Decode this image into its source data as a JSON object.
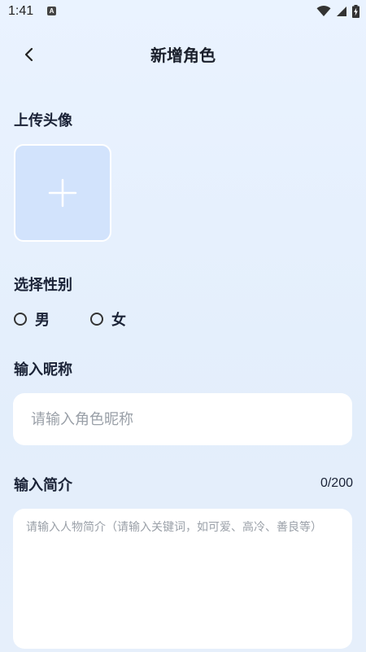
{
  "status_bar": {
    "time": "1:41",
    "notification_badge": "A",
    "icons": [
      "wifi-icon",
      "signal-icon",
      "battery-charging-icon"
    ]
  },
  "header": {
    "title": "新增角色",
    "back_icon": "chevron-left-icon"
  },
  "avatar": {
    "label": "上传头像",
    "upload_icon": "plus-icon"
  },
  "gender": {
    "label": "选择性别",
    "options": [
      {
        "label": "男",
        "selected": false
      },
      {
        "label": "女",
        "selected": false
      }
    ]
  },
  "nickname": {
    "label": "输入昵称",
    "value": "",
    "placeholder": "请输入角色昵称"
  },
  "intro": {
    "label": "输入简介",
    "counter": "0/200",
    "value": "",
    "placeholder": "请输入人物简介（请输入关键词，如可爱、高冷、善良等）"
  },
  "colors": {
    "background": "#e6f0fd",
    "avatar_box": "#d2e3fc",
    "text_primary": "#1a2236",
    "placeholder": "#9aa0a8"
  }
}
